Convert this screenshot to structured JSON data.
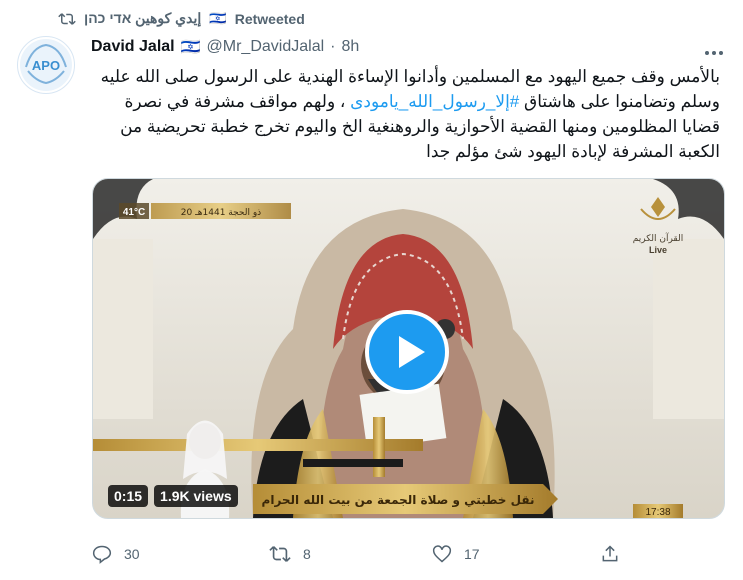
{
  "retweeter": {
    "name": "إيدي كوهين אדי כהן",
    "flag": "🇮🇱",
    "label": "Retweeted"
  },
  "author": {
    "name": "David Jalal",
    "flag": "🇮🇱",
    "handle": "@Mr_DavidJalal",
    "time": "8h",
    "avatar_text": "APO"
  },
  "tweet": {
    "part1": "بالأمس وقف جميع اليهود مع المسلمين وأدانوا الإساءة الهندية على الرسول صلى الله عليه وسلم وتضامنوا على هاشتاق",
    "hashtag": "#إلا_رسول_الله_يامودى",
    "part2": "، ولهم مواقف مشرفة في نصرة قضايا المظلومين ومنها القضية الأحوازية والروهنغية الخ واليوم تخرج خطبة تحريضية من الكعبة المشرفة لإبادة اليهود شئ مؤلم جدا"
  },
  "media": {
    "temperature": "41°C",
    "channel_label": "القرآن الكريم",
    "live_label": "Live",
    "date_text": "20 ذو الحجة 1441هـ",
    "caption": "نقل خطبتي و صلاة الجمعة من بيت الله الحرام",
    "clock": "17:38",
    "duration": "0:15",
    "views": "1.9K views"
  },
  "actions": {
    "replies": "30",
    "retweets": "8",
    "likes": "17"
  },
  "colors": {
    "accent": "#1d9bf0",
    "muted": "#536471",
    "text": "#0f1419"
  }
}
